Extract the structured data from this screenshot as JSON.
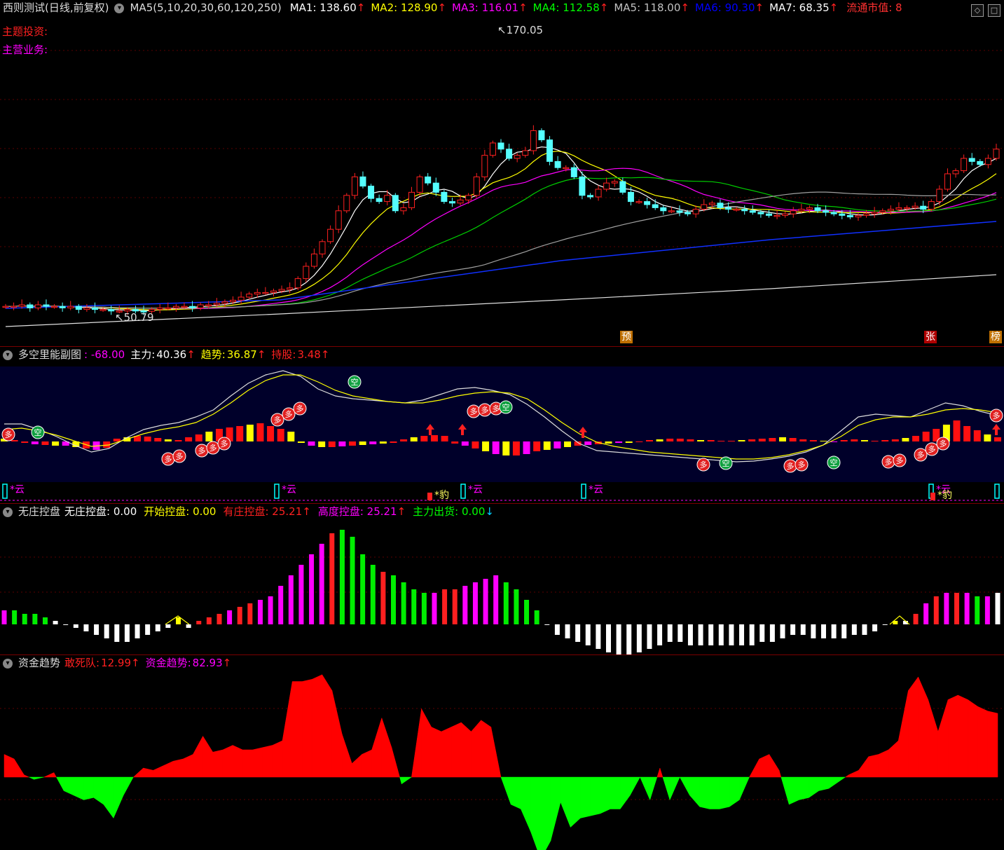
{
  "main_pane": {
    "title": "西则测试(日线,前复权)",
    "legend_prefix": "MA5(5,10,20,30,60,120,250)",
    "ma": [
      {
        "label": "MA1:",
        "value": "138.60",
        "color": "#ffffff"
      },
      {
        "label": "MA2:",
        "value": "128.90",
        "color": "#ffff00"
      },
      {
        "label": "MA3:",
        "value": "116.01",
        "color": "#ff00ff"
      },
      {
        "label": "MA4:",
        "value": "112.58",
        "color": "#00ff00"
      },
      {
        "label": "MA5:",
        "value": "118.00",
        "color": "#c0c0c0"
      },
      {
        "label": "MA6:",
        "value": "90.30",
        "color": "#0000ff"
      },
      {
        "label": "MA7:",
        "value": "68.35",
        "color": "#ffffff"
      }
    ],
    "market_cap_label": "流通市值: 8",
    "theme_invest": "主题投资:",
    "main_business": "主营业务:",
    "high_label": "170.05",
    "low_label": "50.79",
    "badges": {
      "pre": "预",
      "zhang": "张",
      "bang": "榜"
    },
    "closes": [
      54,
      54,
      55,
      53,
      55,
      54,
      54,
      53,
      54,
      52,
      53,
      52,
      52,
      51,
      51,
      52,
      51,
      50.8,
      52,
      53,
      53,
      54,
      54,
      53,
      55,
      55,
      56,
      57,
      58,
      60,
      62,
      63,
      63,
      64,
      65,
      66,
      72,
      80,
      88,
      96,
      104,
      116,
      126,
      138,
      132,
      124,
      122,
      126,
      116,
      118,
      128,
      138,
      134,
      128,
      122,
      121,
      123,
      126,
      138,
      152,
      160,
      156,
      150,
      152,
      155,
      168,
      162,
      148,
      144,
      144,
      138,
      126,
      125,
      130,
      134,
      135,
      128,
      122,
      122,
      120,
      118,
      116,
      116,
      115,
      114,
      117,
      120,
      121,
      118,
      117,
      117,
      116,
      115,
      114,
      113,
      113,
      114,
      116,
      117,
      118,
      116,
      115,
      114,
      113,
      112,
      113,
      114,
      115,
      116,
      117,
      118,
      118,
      119,
      117,
      122,
      130,
      140,
      142,
      150,
      148,
      146,
      150,
      156
    ]
  },
  "sub1": {
    "title": "多空里能副图",
    "val1": ": -68.00",
    "main_force_label": "主力:",
    "main_force": "40.36",
    "trend_label": "趋势:",
    "trend": "36.87",
    "hold_label": "持股:",
    "hold": "3.48",
    "duo": "多",
    "kong": "空",
    "yun": "*云",
    "bao": "*豹"
  },
  "sub2": {
    "title": "无庄控盘",
    "items": [
      {
        "label": "无庄控盘:",
        "value": "0.00",
        "color": "#ffffff",
        "arrow": ""
      },
      {
        "label": "开始控盘:",
        "value": "0.00",
        "color": "#ffff00",
        "arrow": ""
      },
      {
        "label": "有庄控盘:",
        "value": "25.21",
        "color": "#ff2020",
        "arrow": "↑"
      },
      {
        "label": "高度控盘:",
        "value": "25.21",
        "color": "#ff00ff",
        "arrow": "↑"
      },
      {
        "label": "主力出货:",
        "value": "0.00",
        "color": "#00ff00",
        "arrow": "↓"
      }
    ],
    "bars": [
      4,
      4,
      3,
      3,
      2,
      1,
      0,
      -1,
      -2,
      -3,
      -4,
      -5,
      -5,
      -4,
      -3,
      -2,
      -1,
      2,
      -1,
      1,
      2,
      3,
      4,
      5,
      6,
      7,
      8,
      11,
      14,
      17,
      20,
      23,
      26,
      27,
      25,
      20,
      17,
      15,
      14,
      12,
      10,
      9,
      9,
      10,
      10,
      11,
      12,
      13,
      14,
      12,
      10,
      7,
      4,
      0,
      -3,
      -4,
      -5,
      -6,
      -7,
      -8,
      -9,
      -9,
      -8,
      -7,
      -6,
      -5,
      -5,
      -6,
      -6,
      -6,
      -6,
      -6,
      -6,
      -6,
      -5,
      -5,
      -4,
      -3,
      -3,
      -4,
      -4,
      -4,
      -4,
      -3,
      -3,
      -2,
      0,
      1,
      1,
      3,
      6,
      8,
      9,
      9,
      9,
      8,
      8,
      9
    ],
    "bar_colors": [
      "m",
      "g",
      "g",
      "g",
      "g",
      "w",
      "w",
      "w",
      "w",
      "w",
      "w",
      "w",
      "w",
      "w",
      "w",
      "w",
      "w",
      "y",
      "w",
      "r",
      "r",
      "r",
      "m",
      "r",
      "r",
      "m",
      "m",
      "m",
      "m",
      "m",
      "m",
      "m",
      "r",
      "g",
      "g",
      "g",
      "g",
      "r",
      "g",
      "g",
      "g",
      "g",
      "m",
      "r",
      "r",
      "m",
      "m",
      "m",
      "m",
      "g",
      "g",
      "g",
      "g",
      "w",
      "w",
      "w",
      "w",
      "w",
      "w",
      "w",
      "w",
      "w",
      "w",
      "w",
      "w",
      "w",
      "w",
      "w",
      "w",
      "w",
      "w",
      "w",
      "w",
      "w",
      "w",
      "w",
      "w",
      "w",
      "w",
      "w",
      "w",
      "w",
      "w",
      "w",
      "w",
      "w",
      "w",
      "y",
      "w",
      "r",
      "m",
      "r",
      "m",
      "r",
      "m",
      "g",
      "m"
    ]
  },
  "sub3": {
    "title": "资金趋势",
    "dare_label": "敢死队:",
    "dare": "12.99",
    "fund_label": "资金趋势:",
    "fund": "82.93",
    "values": [
      10,
      8,
      1,
      -1,
      0,
      2,
      -6,
      -8,
      -10,
      -9,
      -12,
      -18,
      -8,
      0,
      4,
      3,
      5,
      7,
      8,
      10,
      18,
      11,
      12,
      14,
      12,
      12,
      13,
      14,
      16,
      42,
      42,
      43,
      45,
      38,
      19,
      6,
      10,
      12,
      26,
      13,
      -3,
      0,
      30,
      22,
      20,
      22,
      24,
      20,
      25,
      22,
      0,
      -12,
      -14,
      -24,
      -36,
      -28,
      -11,
      -22,
      -18,
      -17,
      -16,
      -14,
      -14,
      -8,
      0,
      -10,
      4,
      -10,
      0,
      -8,
      -13,
      -14,
      -14,
      -13,
      -10,
      0,
      8,
      10,
      3,
      -12,
      -10,
      -9,
      -6,
      -5,
      -2,
      1,
      3,
      9,
      10,
      12,
      16,
      38,
      44,
      34,
      20,
      34,
      36,
      34,
      31,
      29,
      28
    ]
  }
}
